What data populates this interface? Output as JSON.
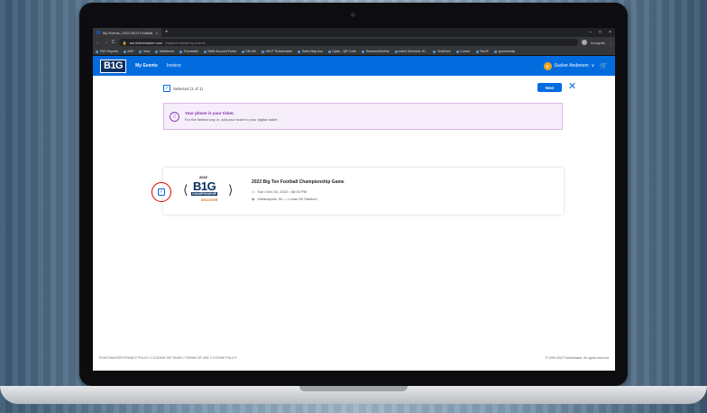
{
  "browser": {
    "tab_title": "My Events | 2022 B1G Football C",
    "tab_close": "×",
    "new_tab": "+",
    "url_host": "am.ticketmaster.com",
    "url_path": "/bigtenfootball/my-events",
    "nav_back": "←",
    "nav_forward": "→",
    "reload": "C",
    "window_min": "–",
    "window_max": "□",
    "window_close": "×",
    "profile_label": "Incognito",
    "bookmarks": [
      "TNS Reports",
      "ADP",
      "Vera",
      "Salesforce",
      "Formstack",
      "NAM Account Portal",
      "DM AM",
      "HELP Ticketmaster",
      "Sales Map.dso",
      "Dylan - QR Code",
      "TeamworkOnline",
      "Intern Schedule 20...",
      "OneDrive",
      "Concur",
      "TaxVF",
      "sponsorship"
    ]
  },
  "site": {
    "logo": "B1G",
    "nav": [
      "My Events",
      "Invoice"
    ],
    "user_initial": "S",
    "user_name": "Sucker Anderson",
    "user_chevron": "∨",
    "cart_icon": "🛒"
  },
  "selection": {
    "check": "✓",
    "label": "Selected (1 of 1)",
    "next_label": "Next",
    "close": "✕"
  },
  "notice": {
    "icon": "▯",
    "title": "Your phone is your ticket.",
    "text": "For the fastest way in, add your ticket to your digital wallet."
  },
  "event": {
    "logo_year": "2022",
    "logo_main": "B1G",
    "logo_sub": "CHAMPIONSHIP",
    "logo_sponsor": "DISCOVER",
    "title": "2022 Big Ten Football Championship Game",
    "date": "Sat • Dec 03, 2022 • 08:00 PM",
    "venue": "Indianapolis, IN — Lucas Oil Stadium",
    "calendar_icon": "▭",
    "pin_icon": "◉"
  },
  "footer": {
    "links": "TICKETMASTER PRIVACY POLICY  //  COOKIE SETTINGS  //  TERMS OF USE  //  COOKIE POLICY",
    "copyright": "© 1999-2022 Ticketmaster. All rights reserved."
  }
}
